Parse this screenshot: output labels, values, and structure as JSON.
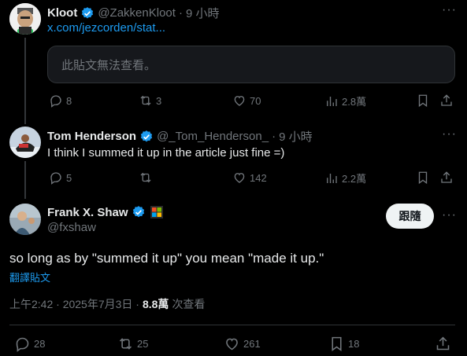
{
  "tweet1": {
    "name": "Kloot",
    "handle": "@ZakkenKloot",
    "sep": "·",
    "time": "9 小時",
    "link": "x.com/jezcorden/stat...",
    "quote_unavailable": "此貼文無法查看。",
    "replies": "8",
    "retweets": "3",
    "likes": "70",
    "views": "2.8萬"
  },
  "tweet2": {
    "name": "Tom Henderson",
    "handle": "@_Tom_Henderson_",
    "sep": "·",
    "time": "9 小時",
    "text": "I think I summed it up in the article just fine =)",
    "replies": "5",
    "retweets": "",
    "likes": "142",
    "views": "2.2萬"
  },
  "main": {
    "name": "Frank X. Shaw",
    "handle": "@fxshaw",
    "follow_label": "跟隨",
    "text": "so long as by \"summed it up\" you mean \"made it up.\"",
    "translate": "翻譯貼文",
    "time": "上午2:42 · 2025年7月3日 ·",
    "views_count": "8.8萬",
    "views_label": "次查看",
    "replies": "28",
    "retweets": "25",
    "likes": "261",
    "bookmarks": "18"
  },
  "colors": {
    "accent": "#1d9bf0",
    "verified": "#1d9bf0",
    "text": "#e7e9ea",
    "muted": "#71767b"
  }
}
